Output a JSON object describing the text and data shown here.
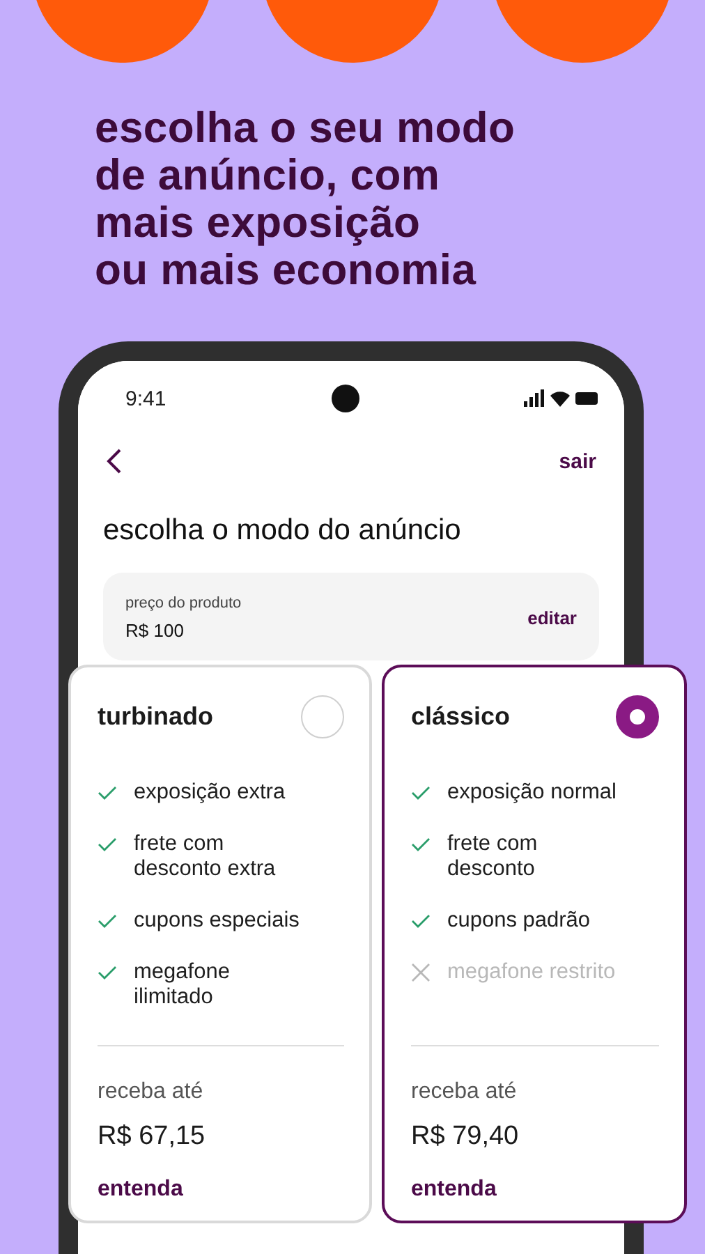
{
  "headline": "escolha o seu modo\nde anúncio, com\n**mais exposição\nou mais economia**",
  "phone": {
    "status_bar": {
      "time": "9:41"
    },
    "nav": {
      "exit": "sair"
    },
    "title": "escolha o modo do anúncio",
    "price_box": {
      "label": "preço do produto",
      "value": "R$ 100",
      "action": "editar"
    },
    "plans": [
      {
        "name": "turbinado",
        "selected": false,
        "features": [
          {
            "text": "exposição extra",
            "included": true
          },
          {
            "text": "frete com\ndesconto extra",
            "included": true
          },
          {
            "text": "cupons especiais",
            "included": true
          },
          {
            "text": "megafone\nilimitado",
            "included": true
          }
        ],
        "receive_label": "receba até",
        "amount": "R$ 67,15",
        "link": "entenda"
      },
      {
        "name": "clássico",
        "selected": true,
        "features": [
          {
            "text": "exposição normal",
            "included": true
          },
          {
            "text": "frete com\ndesconto",
            "included": true
          },
          {
            "text": "cupons padrão",
            "included": true
          },
          {
            "text": "megafone restrito",
            "included": false
          }
        ],
        "receive_label": "receba até",
        "amount": "R$ 79,40",
        "link": "entenda"
      }
    ]
  }
}
